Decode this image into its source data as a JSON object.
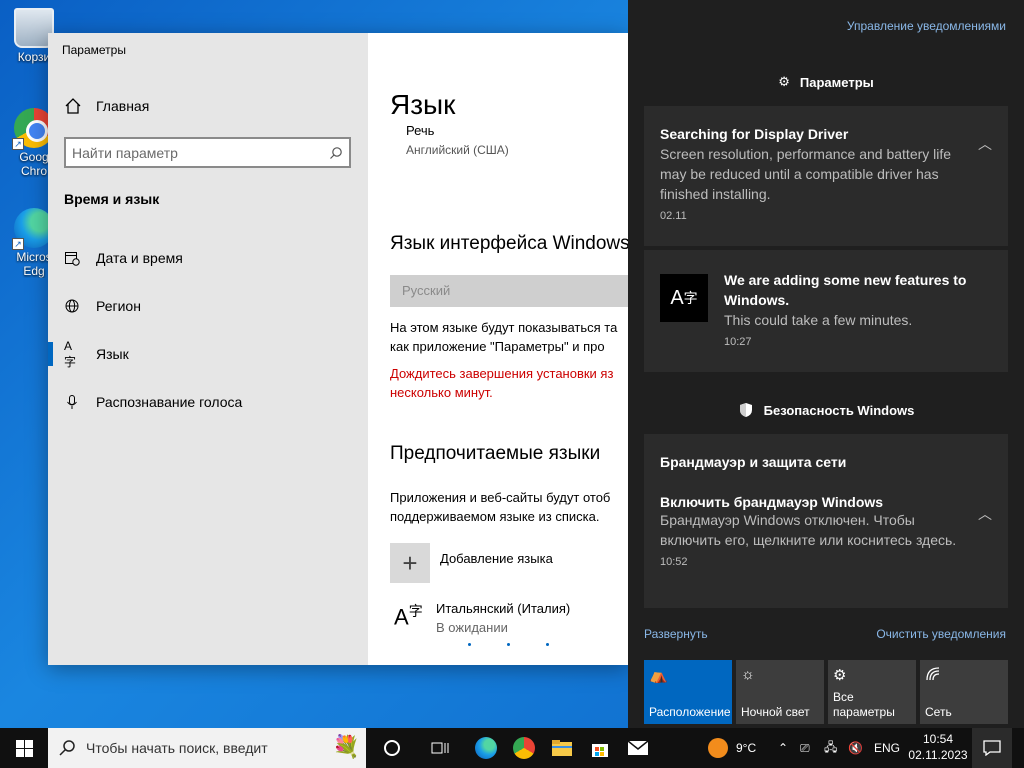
{
  "desktop": {
    "icons": [
      {
        "label": "Корзи",
        "icon": "recycle-bin-icon"
      },
      {
        "label": "Goog Chro",
        "icon": "chrome-icon"
      },
      {
        "label": "Micros Edg",
        "icon": "edge-icon"
      }
    ]
  },
  "settings": {
    "window_title": "Параметры",
    "home_label": "Главная",
    "search_placeholder": "Найти параметр",
    "section_title": "Время и язык",
    "nav": [
      {
        "label": "Дата и время",
        "icon": "calendar-clock-icon"
      },
      {
        "label": "Регион",
        "icon": "globe-icon"
      },
      {
        "label": "Язык",
        "icon": "language-icon",
        "active": true
      },
      {
        "label": "Распознавание голоса",
        "icon": "microphone-icon"
      }
    ],
    "main": {
      "title": "Язык",
      "speech_title": "Речь",
      "speech_value": "Английский (США)",
      "interface_heading": "Язык интерфейса Windows",
      "interface_value": "Русский",
      "interface_desc_1": "На этом языке будут показываться та",
      "interface_desc_2": "как приложение \"Параметры\" и про",
      "warning_1": "Дождитесь завершения установки яз",
      "warning_2": "несколько минут.",
      "preferred_heading": "Предпочитаемые языки",
      "preferred_desc_1": "Приложения и веб-сайты будут отоб",
      "preferred_desc_2": "поддерживаемом языке из списка.",
      "add_language": "Добавление языка",
      "language_name": "Итальянский (Италия)",
      "language_status": "В ожидании"
    }
  },
  "action_center": {
    "manage_link": "Управление уведомлениями",
    "group_settings": "Параметры",
    "card_driver": {
      "title": "Searching for Display Driver",
      "body": "Screen resolution, performance and battery life may be reduced until a compatible driver has finished installing.",
      "time": "02.11"
    },
    "card_features": {
      "title": "We are adding some new features to Windows.",
      "body": "This could take a few minutes.",
      "time": "10:27"
    },
    "group_security": "Безопасность Windows",
    "card_firewall": {
      "header": "Брандмауэр и защита сети",
      "title": "Включить брандмауэр Windows",
      "body": "Брандмауэр Windows отключен. Чтобы включить его, щелкните или коснитесь здесь.",
      "time": "10:52"
    },
    "expand_link": "Развернуть",
    "clear_link": "Очистить уведомления",
    "tiles": [
      {
        "label": "Расположение",
        "icon": "location-icon",
        "active": true
      },
      {
        "label": "Ночной свет",
        "icon": "night-light-icon",
        "active": false
      },
      {
        "label": "Все параметры",
        "icon": "gear-icon",
        "active": false
      },
      {
        "label": "Сеть",
        "icon": "network-icon",
        "active": false
      }
    ]
  },
  "taskbar": {
    "search_placeholder": "Чтобы начать поиск, введит",
    "weather": "9°C",
    "lang": "ENG",
    "time": "10:54",
    "date": "02.11.2023"
  }
}
